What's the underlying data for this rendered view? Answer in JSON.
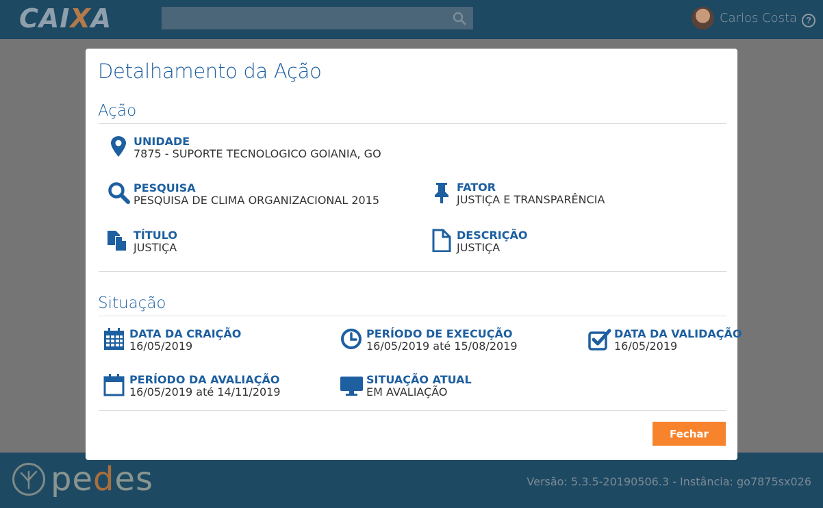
{
  "header": {
    "logo_left": "CAI",
    "logo_x": "X",
    "logo_right": "A",
    "search": {
      "value": "",
      "placeholder": ""
    },
    "user_name": "Carlos Costa",
    "help_label": "?"
  },
  "modal": {
    "title": "Detalhamento da Ação",
    "acao": {
      "title": "Ação",
      "unidade": {
        "label": "UNIDADE",
        "value": "7875 - SUPORTE TECNOLOGICO GOIANIA, GO"
      },
      "pesquisa": {
        "label": "PESQUISA",
        "value": "PESQUISA DE CLIMA ORGANIZACIONAL 2015"
      },
      "fator": {
        "label": "FATOR",
        "value": "JUSTIÇA E TRANSPARÊNCIA"
      },
      "titulo": {
        "label": "TÍTULO",
        "value": "JUSTIÇA"
      },
      "descricao": {
        "label": "DESCRIÇÃO",
        "value": "JUSTIÇA"
      }
    },
    "situacao": {
      "title": "Situação",
      "data_criacao": {
        "label": "DATA DA CRAIÇÃO",
        "value": "16/05/2019"
      },
      "periodo_execucao": {
        "label": "PERÍODO DE EXECUÇÃO",
        "value": "16/05/2019 até 15/08/2019"
      },
      "data_validacao": {
        "label": "DATA DA VALIDAÇÃO",
        "value": "16/05/2019"
      },
      "periodo_avaliacao": {
        "label": "PERÍODO DA AVALIAÇÃO",
        "value": "16/05/2019 até 14/11/2019"
      },
      "situacao_atual": {
        "label": "SITUAÇÃO ATUAL",
        "value": "EM AVALIAÇÃO"
      }
    },
    "close_label": "Fechar"
  },
  "footer": {
    "brand_p": "pe",
    "brand_o": "d",
    "brand_rest": "es",
    "version": "Versão: 5.3.5-20190506.3 - Instância: go7875sx026"
  },
  "colors": {
    "header_bg": "#1e4963",
    "accent_blue": "#1d5fa0",
    "button_orange": "#f7842d",
    "overlay": "#757575"
  }
}
